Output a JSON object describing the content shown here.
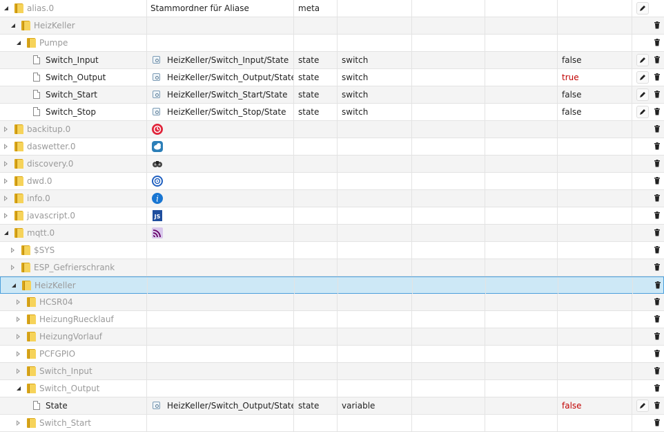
{
  "rows": [
    {
      "level": 0,
      "toggle": "open",
      "icon": "folder",
      "name": "alias.0",
      "name_style": "muted",
      "desc": "Stammordner für Aliase",
      "type": "meta",
      "role": "",
      "value": "",
      "value_style": "",
      "edit": true,
      "adapter": ""
    },
    {
      "level": 1,
      "toggle": "open",
      "icon": "folder",
      "name": "HeizKeller",
      "name_style": "muted",
      "desc": "",
      "type": "",
      "role": "",
      "value": "",
      "value_style": "",
      "edit": false,
      "adapter": ""
    },
    {
      "level": 2,
      "toggle": "open",
      "icon": "folder",
      "name": "Pumpe",
      "name_style": "muted",
      "desc": "",
      "type": "",
      "role": "",
      "value": "",
      "value_style": "",
      "edit": false,
      "adapter": ""
    },
    {
      "level": 3,
      "toggle": "none",
      "icon": "file",
      "name": "Switch_Input",
      "name_style": "dark",
      "desc": "HeizKeller/Switch_Input/State",
      "type": "state",
      "role": "switch",
      "value": "false",
      "value_style": "dark",
      "edit": true,
      "adapter": "",
      "state_icon": true
    },
    {
      "level": 3,
      "toggle": "none",
      "icon": "file",
      "name": "Switch_Output",
      "name_style": "dark",
      "desc": "HeizKeller/Switch_Output/State",
      "type": "state",
      "role": "switch",
      "value": "true",
      "value_style": "red",
      "edit": true,
      "adapter": "",
      "state_icon": true
    },
    {
      "level": 3,
      "toggle": "none",
      "icon": "file",
      "name": "Switch_Start",
      "name_style": "dark",
      "desc": "HeizKeller/Switch_Start/State",
      "type": "state",
      "role": "switch",
      "value": "false",
      "value_style": "dark",
      "edit": true,
      "adapter": "",
      "state_icon": true
    },
    {
      "level": 3,
      "toggle": "none",
      "icon": "file",
      "name": "Switch_Stop",
      "name_style": "dark",
      "desc": "HeizKeller/Switch_Stop/State",
      "type": "state",
      "role": "switch",
      "value": "false",
      "value_style": "dark",
      "edit": true,
      "adapter": "",
      "state_icon": true
    },
    {
      "level": 0,
      "toggle": "closed",
      "icon": "folder",
      "name": "backitup.0",
      "name_style": "muted",
      "desc": "",
      "type": "",
      "role": "",
      "value": "",
      "value_style": "",
      "edit": false,
      "adapter": "backitup"
    },
    {
      "level": 0,
      "toggle": "closed",
      "icon": "folder",
      "name": "daswetter.0",
      "name_style": "muted",
      "desc": "",
      "type": "",
      "role": "",
      "value": "",
      "value_style": "",
      "edit": false,
      "adapter": "daswetter"
    },
    {
      "level": 0,
      "toggle": "closed",
      "icon": "folder",
      "name": "discovery.0",
      "name_style": "muted",
      "desc": "",
      "type": "",
      "role": "",
      "value": "",
      "value_style": "",
      "edit": false,
      "adapter": "discovery"
    },
    {
      "level": 0,
      "toggle": "closed",
      "icon": "folder",
      "name": "dwd.0",
      "name_style": "muted",
      "desc": "",
      "type": "",
      "role": "",
      "value": "",
      "value_style": "",
      "edit": false,
      "adapter": "dwd"
    },
    {
      "level": 0,
      "toggle": "closed",
      "icon": "folder",
      "name": "info.0",
      "name_style": "muted",
      "desc": "",
      "type": "",
      "role": "",
      "value": "",
      "value_style": "",
      "edit": false,
      "adapter": "info"
    },
    {
      "level": 0,
      "toggle": "closed",
      "icon": "folder",
      "name": "javascript.0",
      "name_style": "muted",
      "desc": "",
      "type": "",
      "role": "",
      "value": "",
      "value_style": "",
      "edit": false,
      "adapter": "javascript"
    },
    {
      "level": 0,
      "toggle": "open",
      "icon": "folder",
      "name": "mqtt.0",
      "name_style": "muted",
      "desc": "",
      "type": "",
      "role": "",
      "value": "",
      "value_style": "",
      "edit": false,
      "adapter": "mqtt"
    },
    {
      "level": 1,
      "toggle": "closed",
      "icon": "folder",
      "name": "$SYS",
      "name_style": "muted",
      "desc": "",
      "type": "",
      "role": "",
      "value": "",
      "value_style": "",
      "edit": false,
      "adapter": ""
    },
    {
      "level": 1,
      "toggle": "closed",
      "icon": "folder",
      "name": "ESP_Gefrierschrank",
      "name_style": "muted",
      "desc": "",
      "type": "",
      "role": "",
      "value": "",
      "value_style": "",
      "edit": false,
      "adapter": ""
    },
    {
      "level": 1,
      "toggle": "open",
      "icon": "folder",
      "name": "HeizKeller",
      "name_style": "muted",
      "desc": "",
      "type": "",
      "role": "",
      "value": "",
      "value_style": "",
      "edit": false,
      "adapter": "",
      "selected": true
    },
    {
      "level": 2,
      "toggle": "closed",
      "icon": "folder",
      "name": "HCSR04",
      "name_style": "muted",
      "desc": "",
      "type": "",
      "role": "",
      "value": "",
      "value_style": "",
      "edit": false,
      "adapter": ""
    },
    {
      "level": 2,
      "toggle": "closed",
      "icon": "folder",
      "name": "HeizungRuecklauf",
      "name_style": "muted",
      "desc": "",
      "type": "",
      "role": "",
      "value": "",
      "value_style": "",
      "edit": false,
      "adapter": ""
    },
    {
      "level": 2,
      "toggle": "closed",
      "icon": "folder",
      "name": "HeizungVorlauf",
      "name_style": "muted",
      "desc": "",
      "type": "",
      "role": "",
      "value": "",
      "value_style": "",
      "edit": false,
      "adapter": ""
    },
    {
      "level": 2,
      "toggle": "closed",
      "icon": "folder",
      "name": "PCFGPIO",
      "name_style": "muted",
      "desc": "",
      "type": "",
      "role": "",
      "value": "",
      "value_style": "",
      "edit": false,
      "adapter": ""
    },
    {
      "level": 2,
      "toggle": "closed",
      "icon": "folder",
      "name": "Switch_Input",
      "name_style": "muted",
      "desc": "",
      "type": "",
      "role": "",
      "value": "",
      "value_style": "",
      "edit": false,
      "adapter": ""
    },
    {
      "level": 2,
      "toggle": "open",
      "icon": "folder",
      "name": "Switch_Output",
      "name_style": "muted",
      "desc": "",
      "type": "",
      "role": "",
      "value": "",
      "value_style": "",
      "edit": false,
      "adapter": ""
    },
    {
      "level": 3,
      "toggle": "none",
      "icon": "file",
      "name": "State",
      "name_style": "dark",
      "desc": "HeizKeller/Switch_Output/State",
      "type": "state",
      "role": "variable",
      "value": "false",
      "value_style": "red",
      "edit": true,
      "adapter": "",
      "state_icon": true
    },
    {
      "level": 2,
      "toggle": "closed",
      "icon": "folder",
      "name": "Switch_Start",
      "name_style": "muted",
      "desc": "",
      "type": "",
      "role": "",
      "value": "",
      "value_style": "",
      "edit": false,
      "adapter": ""
    }
  ]
}
